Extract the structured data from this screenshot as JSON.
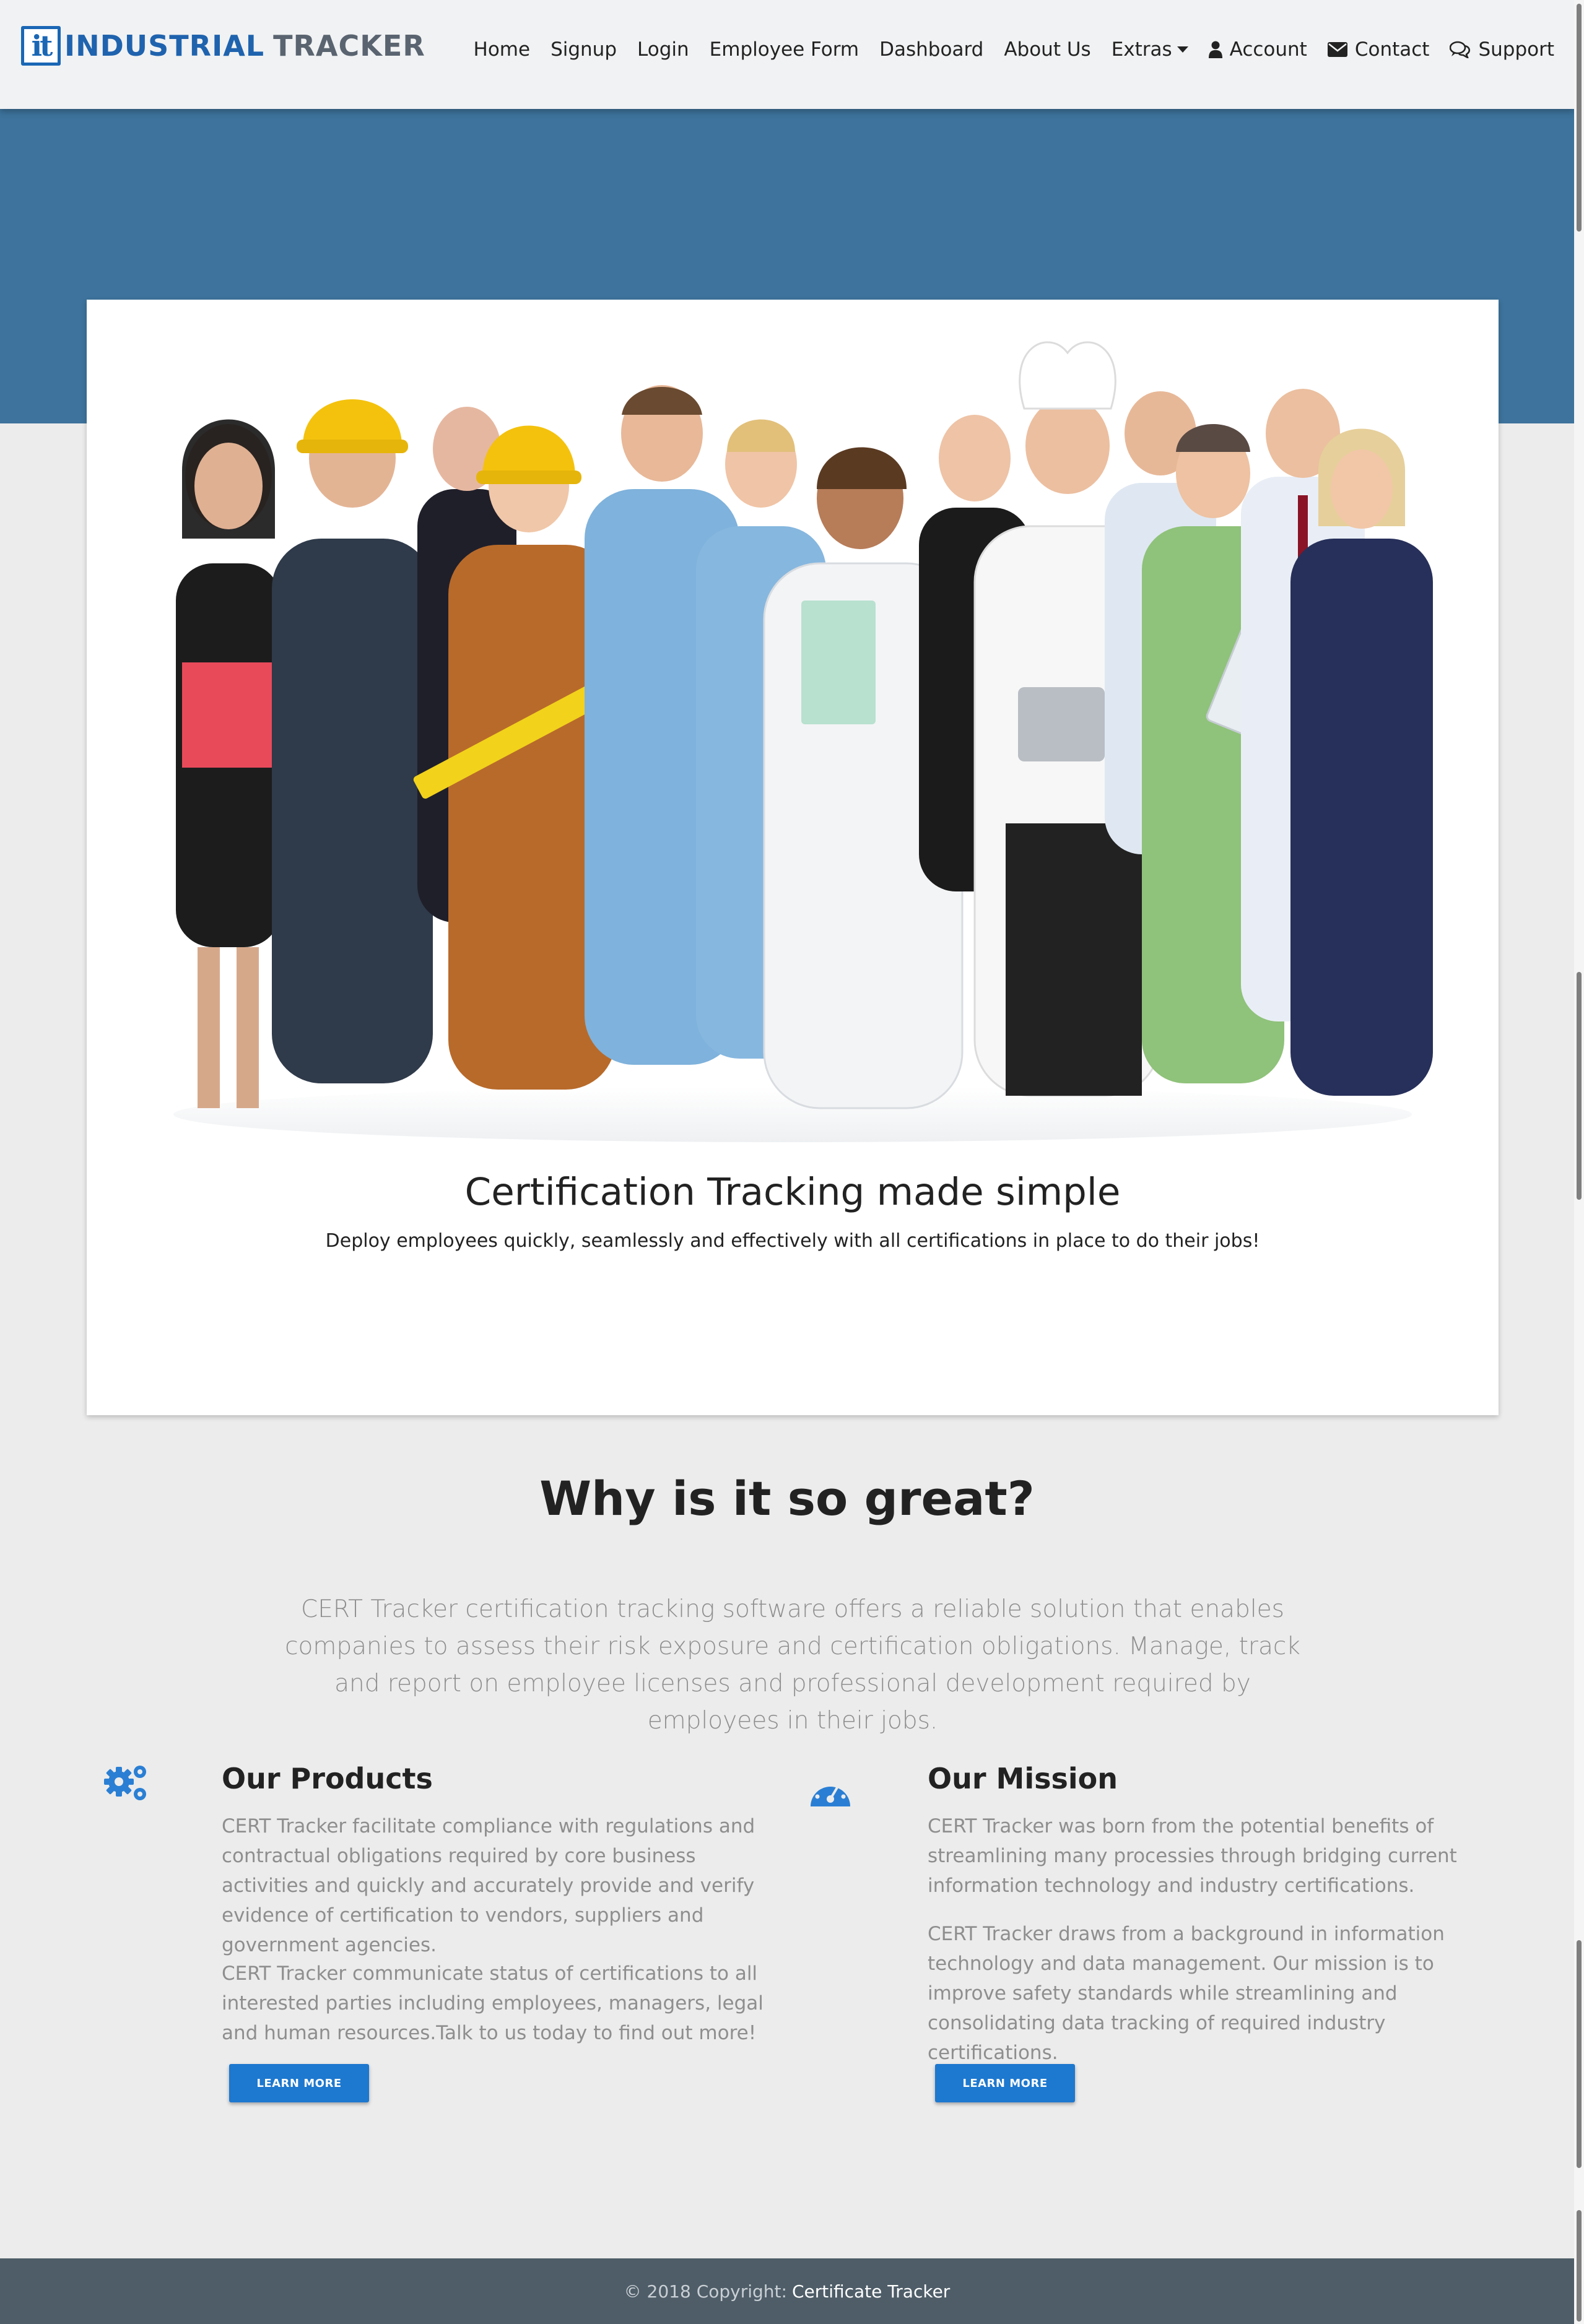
{
  "nav": {
    "brand_line1": "INDUSTRIAL",
    "brand_line2": "TRACKER",
    "brand_mark": "it",
    "links": {
      "home": "Home",
      "signup": "Signup",
      "login": "Login",
      "employee_form": "Employee Form",
      "dashboard": "Dashboard",
      "about": "About Us",
      "extras": "Extras",
      "account": "Account",
      "contact": "Contact",
      "support": "Support"
    },
    "icons": [
      "user-icon",
      "envelope-icon",
      "chat-bubbles-icon",
      "chevron-down-icon"
    ]
  },
  "hero": {
    "title": "Certification Tracking made simple",
    "subtitle": "Deploy employees quickly, seamlessly and effectively with all certifications in place to do their jobs!"
  },
  "why": {
    "heading": "Why is it so great?",
    "lead": "CERT Tracker certification tracking software offers a reliable solution that enables companies to assess their risk exposure and certification obligations. Manage, track and report on employee licenses and professional development required by employees in their jobs."
  },
  "products": {
    "title": "Our Products",
    "icon": "gears-icon",
    "p1": "CERT Tracker facilitate compliance with regulations and contractual obligations required by core business activities and quickly and accurately provide and verify evidence of certification to vendors, suppliers and government agencies.",
    "p2": "CERT Tracker communicate status of certifications to all interested parties including employees, managers, legal and human resources.Talk to us today to find out more!",
    "button": "LEARN MORE"
  },
  "mission": {
    "title": "Our Mission",
    "icon": "dashboard-gauge-icon",
    "p1": "CERT Tracker was born from the potential benefits of streamlining many processies through bridging current information technology and industry certifications.",
    "p2": "CERT Tracker draws from a background in information technology and data management. Our mission is to improve safety standards while streamlining and consolidating data tracking of required industry certifications.",
    "button": "LEARN MORE"
  },
  "footer": {
    "copyright": "© 2018 Copyright:",
    "brand": "Certificate Tracker"
  },
  "colors": {
    "banner": "#3d739c",
    "accent": "#1d78cf",
    "footer": "#4e5d68",
    "brand_blue": "#1f63ae"
  }
}
